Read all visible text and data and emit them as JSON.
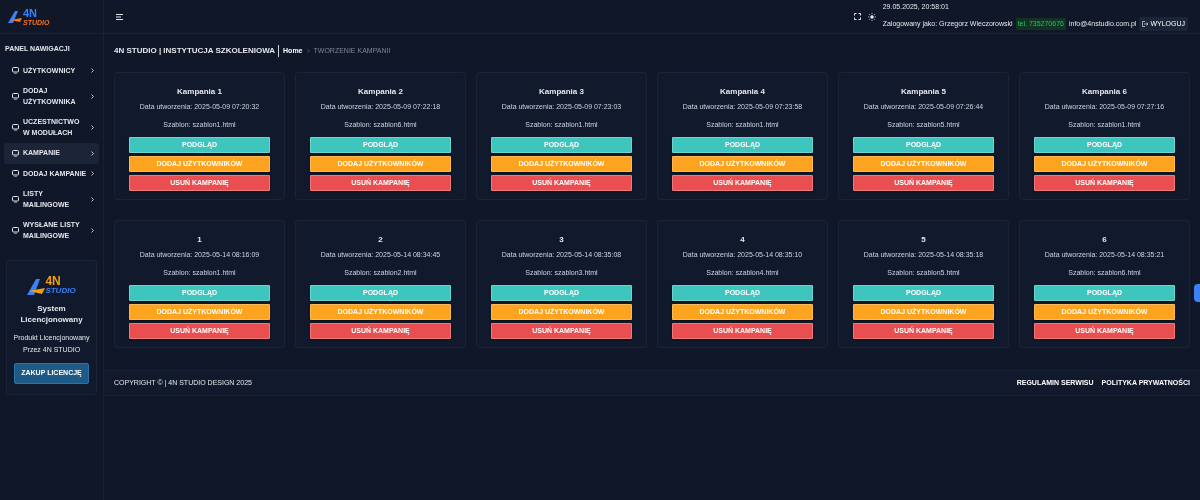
{
  "logo": {
    "big": "4N",
    "small": "STUDIO"
  },
  "header": {
    "datetime": "29.05.2025, 20:58:01",
    "logged_as": "Zalogowany jako: Grzegorz Wieczorowski",
    "phone": "tel. 735270676",
    "email": "info@4nstudio.com.pl",
    "logout": "WYLOGUJ"
  },
  "sidebar": {
    "title": "PANEL NAWIGACJI",
    "items": [
      {
        "label": "UŻYTKOWNICY",
        "selected": false
      },
      {
        "label": "DODAJ UŻYTKOWNIKA",
        "selected": false
      },
      {
        "label": "UCZESTNICTWO W MODUŁACH",
        "selected": false
      },
      {
        "label": "KAMPANIE",
        "selected": true
      },
      {
        "label": "DODAJ KAMPANIE",
        "selected": false
      },
      {
        "label": "LISTY MAILINGOWE",
        "selected": false
      },
      {
        "label": "WYSŁANE LISTY MAILINGOWE",
        "selected": false
      }
    ],
    "license": {
      "logo_big": "4N",
      "logo_small": "STUDIO",
      "title": "System Licencjonowany",
      "lines": [
        "Produkt Licencjonowany",
        "Przez 4N STUDIO"
      ],
      "button": "ZAKUP LICENCJĘ"
    }
  },
  "page": {
    "title": "4N STUDIO | INSTYTUCJA SZKOLENIOWA",
    "breadcrumb": [
      "Home",
      "TWORZENIE KAMPANII"
    ]
  },
  "campaign_rows": [
    [
      {
        "name": "Kampania 1",
        "created": "Data utworzenia: 2025-05-09 07:20:32",
        "template": "Szablon: szablon1.html",
        "buttons": [
          {
            "kind": "view",
            "label": "PODGLĄD"
          },
          {
            "kind": "add",
            "label": "DODAJ UŻYTKOWNIKÓW"
          },
          {
            "kind": "delete",
            "label": "USUŃ KAMPANIĘ"
          }
        ]
      },
      {
        "name": "Kampania 2",
        "created": "Data utworzenia: 2025-05-09 07:22:18",
        "template": "Szablon: szablon6.html",
        "buttons": [
          {
            "kind": "view",
            "label": "PODGLĄD"
          },
          {
            "kind": "add",
            "label": "DODAJ UŻYTKOWNIKÓW"
          },
          {
            "kind": "delete",
            "label": "USUŃ KAMPANIĘ"
          }
        ]
      },
      {
        "name": "Kampania 3",
        "created": "Data utworzenia: 2025-05-09 07:23:03",
        "template": "Szablon: szablon1.html",
        "buttons": [
          {
            "kind": "view",
            "label": "PODGLĄD"
          },
          {
            "kind": "add",
            "label": "DODAJ UŻYTKOWNIKÓW"
          },
          {
            "kind": "delete",
            "label": "USUŃ KAMPANIĘ"
          }
        ]
      },
      {
        "name": "Kampania 4",
        "created": "Data utworzenia: 2025-05-09 07:23:58",
        "template": "Szablon: szablon1.html",
        "buttons": [
          {
            "kind": "view",
            "label": "PODGLĄD"
          },
          {
            "kind": "add",
            "label": "DODAJ UŻYTKOWNIKÓW"
          },
          {
            "kind": "delete",
            "label": "USUŃ KAMPANIĘ"
          }
        ]
      },
      {
        "name": "Kampania 5",
        "created": "Data utworzenia: 2025-05-09 07:26:44",
        "template": "Szablon: szablon5.html",
        "buttons": [
          {
            "kind": "view",
            "label": "PODGLĄD"
          },
          {
            "kind": "add",
            "label": "DODAJ UŻYTKOWNIKÓW"
          },
          {
            "kind": "delete",
            "label": "USUŃ KAMPANIĘ"
          }
        ]
      },
      {
        "name": "Kampania 6",
        "created": "Data utworzenia: 2025-05-09 07:27:16",
        "template": "Szablon: szablon1.html",
        "buttons": [
          {
            "kind": "view",
            "label": "PODGLĄD"
          },
          {
            "kind": "add",
            "label": "DODAJ UŻYTKOWNIKÓW"
          },
          {
            "kind": "delete",
            "label": "USUŃ KAMPANIĘ"
          }
        ]
      }
    ],
    [
      {
        "name": "1",
        "created": "Data utworzenia: 2025-05-14 08:16:09",
        "template": "Szablon: szablon1.html",
        "buttons": [
          {
            "kind": "view",
            "label": "PODGLĄD"
          },
          {
            "kind": "add",
            "label": "DODAJ UŻYTKOWNIKÓW"
          },
          {
            "kind": "delete",
            "label": "USUŃ KAMPANIĘ"
          }
        ]
      },
      {
        "name": "2",
        "created": "Data utworzenia: 2025-05-14 08:34:45",
        "template": "Szablon: szablon2.html",
        "buttons": [
          {
            "kind": "view",
            "label": "PODGLĄD"
          },
          {
            "kind": "add",
            "label": "DODAJ UŻYTKOWNIKÓW"
          },
          {
            "kind": "delete",
            "label": "USUŃ KAMPANIĘ"
          }
        ]
      },
      {
        "name": "3",
        "created": "Data utworzenia: 2025-05-14 08:35:08",
        "template": "Szablon: szablon3.html",
        "buttons": [
          {
            "kind": "view",
            "label": "PODGLĄD"
          },
          {
            "kind": "add",
            "label": "DODAJ UŻYTKOWNIKÓW"
          },
          {
            "kind": "delete",
            "label": "USUŃ KAMPANIĘ"
          }
        ]
      },
      {
        "name": "4",
        "created": "Data utworzenia: 2025-05-14 08:35:10",
        "template": "Szablon: szablon4.html",
        "buttons": [
          {
            "kind": "view",
            "label": "PODGLĄD"
          },
          {
            "kind": "add",
            "label": "DODAJ UŻYTKOWNIKÓW"
          },
          {
            "kind": "delete",
            "label": "USUŃ KAMPANIĘ"
          }
        ]
      },
      {
        "name": "5",
        "created": "Data utworzenia: 2025-05-14 08:35:18",
        "template": "Szablon: szablon5.html",
        "buttons": [
          {
            "kind": "view",
            "label": "PODGLĄD"
          },
          {
            "kind": "add",
            "label": "DODAJ UŻYTKOWNIKÓW"
          },
          {
            "kind": "delete",
            "label": "USUŃ KAMPANIĘ"
          }
        ]
      },
      {
        "name": "6",
        "created": "Data utworzenia: 2025-05-14 08:35:21",
        "template": "Szablon: szablon6.html",
        "buttons": [
          {
            "kind": "view",
            "label": "PODGLĄD"
          },
          {
            "kind": "add",
            "label": "DODAJ UŻYTKOWNIKÓW"
          },
          {
            "kind": "delete",
            "label": "USUŃ KAMPANIĘ"
          }
        ]
      }
    ]
  ],
  "footer": {
    "copyright": "COPYRIGHT © | 4N STUDIO DESIGN 2025",
    "links": [
      "REGULAMIN SERWISU",
      "POLITYKA PRYWATNOŚCI"
    ]
  }
}
